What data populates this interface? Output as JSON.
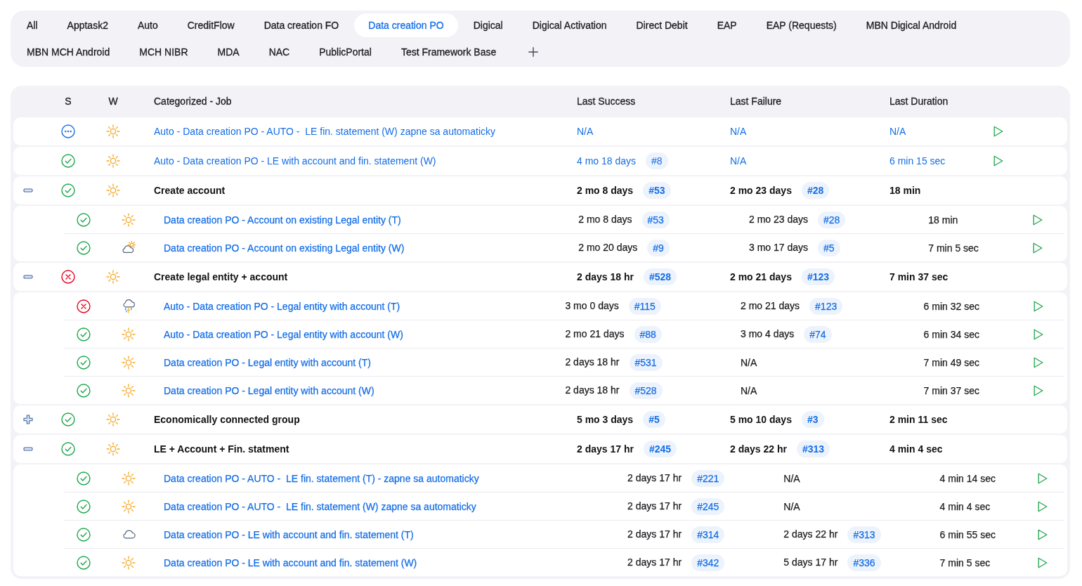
{
  "tabs": [
    {
      "label": "All",
      "selected": false
    },
    {
      "label": "Apptask2",
      "selected": false
    },
    {
      "label": "Auto",
      "selected": false
    },
    {
      "label": "CreditFlow",
      "selected": false
    },
    {
      "label": "Data creation FO",
      "selected": false
    },
    {
      "label": "Data creation PO",
      "selected": true
    },
    {
      "label": "Digical",
      "selected": false
    },
    {
      "label": "Digical Activation",
      "selected": false
    },
    {
      "label": "Direct Debit",
      "selected": false
    },
    {
      "label": "EAP",
      "selected": false
    },
    {
      "label": "EAP (Requests)",
      "selected": false
    },
    {
      "label": "MBN Digical Android",
      "selected": false
    },
    {
      "label": "MBN MCH Android",
      "selected": false
    },
    {
      "label": "MCH NIBR",
      "selected": false
    },
    {
      "label": "MDA",
      "selected": false
    },
    {
      "label": "NAC",
      "selected": false
    },
    {
      "label": "PublicPortal",
      "selected": false
    },
    {
      "label": "Test Framework Base",
      "selected": false
    }
  ],
  "table": {
    "columns": [
      "S",
      "W",
      "Categorized - Job",
      "Last Success",
      "Last Failure",
      "Last Duration"
    ],
    "rows": [
      {
        "kind": "job",
        "status": {
          "kind": "pending"
        },
        "weather": {
          "kind": "sunny"
        },
        "name": "Auto - Data creation PO - AUTO -  LE fin. statement (W) zapne sa automaticky",
        "last_success": {
          "time": "N/A"
        },
        "last_failure": {
          "time": "N/A"
        },
        "last_duration": "N/A"
      },
      {
        "kind": "job",
        "status": {
          "kind": "success"
        },
        "weather": {
          "kind": "sunny"
        },
        "name": "Auto - Data creation PO - LE with account and fin. statement (W)",
        "last_success": {
          "time": "4 mo 18 days",
          "build": "#8"
        },
        "last_failure": {
          "time": "N/A"
        },
        "last_duration": "6 min 15 sec"
      },
      {
        "kind": "group",
        "expanded": true,
        "status": {
          "kind": "success"
        },
        "weather": {
          "kind": "sunny"
        },
        "name": "Create account",
        "last_success": {
          "time": "2 mo 8 days",
          "build": "#53"
        },
        "last_failure": {
          "time": "2 mo 23 days",
          "build": "#28"
        },
        "last_duration": "18 min",
        "children": [
          {
            "kind": "job",
            "status": {
              "kind": "success"
            },
            "weather": {
              "kind": "sunny"
            },
            "name": "Data creation PO - Account on existing Legal entity (T)",
            "last_success": {
              "time": "2 mo 8 days",
              "build": "#53"
            },
            "last_failure": {
              "time": "2 mo 23 days",
              "build": "#28"
            },
            "last_duration": "18 min"
          },
          {
            "kind": "job",
            "status": {
              "kind": "success"
            },
            "weather": {
              "kind": "partly_cloudy"
            },
            "name": "Data creation PO - Account on existing Legal entity (W)",
            "last_success": {
              "time": "2 mo 20 days",
              "build": "#9"
            },
            "last_failure": {
              "time": "3 mo 17 days",
              "build": "#5"
            },
            "last_duration": "7 min 5 sec"
          }
        ]
      },
      {
        "kind": "group",
        "expanded": true,
        "status": {
          "kind": "failed"
        },
        "weather": {
          "kind": "sunny"
        },
        "name": "Create legal entity + account",
        "last_success": {
          "time": "2 days 18 hr",
          "build": "#528"
        },
        "last_failure": {
          "time": "2 mo 21 days",
          "build": "#123"
        },
        "last_duration": "7 min 37 sec",
        "children": [
          {
            "kind": "job",
            "status": {
              "kind": "failed"
            },
            "weather": {
              "kind": "stormy"
            },
            "name": "Auto - Data creation PO - Legal entity with account (T)",
            "last_success": {
              "time": "3 mo 0 days",
              "build": "#115"
            },
            "last_failure": {
              "time": "2 mo 21 days",
              "build": "#123"
            },
            "last_duration": "6 min 32 sec"
          },
          {
            "kind": "job",
            "status": {
              "kind": "success"
            },
            "weather": {
              "kind": "sunny"
            },
            "name": "Auto - Data creation PO - Legal entity with account (W)",
            "last_success": {
              "time": "2 mo 21 days",
              "build": "#88"
            },
            "last_failure": {
              "time": "3 mo 4 days",
              "build": "#74"
            },
            "last_duration": "6 min 34 sec"
          },
          {
            "kind": "job",
            "status": {
              "kind": "success"
            },
            "weather": {
              "kind": "sunny"
            },
            "name": "Data creation PO - Legal entity with account (T)",
            "last_success": {
              "time": "2 days 18 hr",
              "build": "#531"
            },
            "last_failure": {
              "time": "N/A"
            },
            "last_duration": "7 min 49 sec"
          },
          {
            "kind": "job",
            "status": {
              "kind": "success"
            },
            "weather": {
              "kind": "sunny"
            },
            "name": "Data creation PO - Legal entity with account (W)",
            "last_success": {
              "time": "2 days 18 hr",
              "build": "#528"
            },
            "last_failure": {
              "time": "N/A"
            },
            "last_duration": "7 min 37 sec"
          }
        ]
      },
      {
        "kind": "group",
        "expanded": false,
        "status": {
          "kind": "success"
        },
        "weather": {
          "kind": "sunny"
        },
        "name": "Economically connected group",
        "last_success": {
          "time": "5 mo 3 days",
          "build": "#5"
        },
        "last_failure": {
          "time": "5 mo 10 days",
          "build": "#3"
        },
        "last_duration": "2 min 11 sec"
      },
      {
        "kind": "group",
        "expanded": true,
        "status": {
          "kind": "success"
        },
        "weather": {
          "kind": "sunny"
        },
        "name": "LE + Account + Fin. statment",
        "last_success": {
          "time": "2 days 17 hr",
          "build": "#245"
        },
        "last_failure": {
          "time": "2 days 22 hr",
          "build": "#313"
        },
        "last_duration": "4 min 4 sec",
        "children": [
          {
            "kind": "job",
            "status": {
              "kind": "success"
            },
            "weather": {
              "kind": "sunny"
            },
            "name": "Data creation PO - AUTO -  LE fin. statement (T) - zapne sa automaticky",
            "last_success": {
              "time": "2 days 17 hr",
              "build": "#221"
            },
            "last_failure": {
              "time": "N/A"
            },
            "last_duration": "4 min 14 sec"
          },
          {
            "kind": "job",
            "status": {
              "kind": "success"
            },
            "weather": {
              "kind": "sunny"
            },
            "name": "Data creation PO - AUTO -  LE fin. statement (W) zapne sa automaticky",
            "last_success": {
              "time": "2 days 17 hr",
              "build": "#245"
            },
            "last_failure": {
              "time": "N/A"
            },
            "last_duration": "4 min 4 sec"
          },
          {
            "kind": "job",
            "status": {
              "kind": "success"
            },
            "weather": {
              "kind": "cloudy"
            },
            "name": "Data creation PO - LE with account and fin. statement (T)",
            "last_success": {
              "time": "2 days 17 hr",
              "build": "#314"
            },
            "last_failure": {
              "time": "2 days 22 hr",
              "build": "#313"
            },
            "last_duration": "6 min 55 sec"
          },
          {
            "kind": "job",
            "status": {
              "kind": "success"
            },
            "weather": {
              "kind": "sunny"
            },
            "name": "Data creation PO - LE with account and fin. statement (W)",
            "last_success": {
              "time": "2 days 17 hr",
              "build": "#342"
            },
            "last_failure": {
              "time": "5 days 17 hr",
              "build": "#336"
            },
            "last_duration": "7 min 5 sec"
          }
        ]
      }
    ]
  }
}
